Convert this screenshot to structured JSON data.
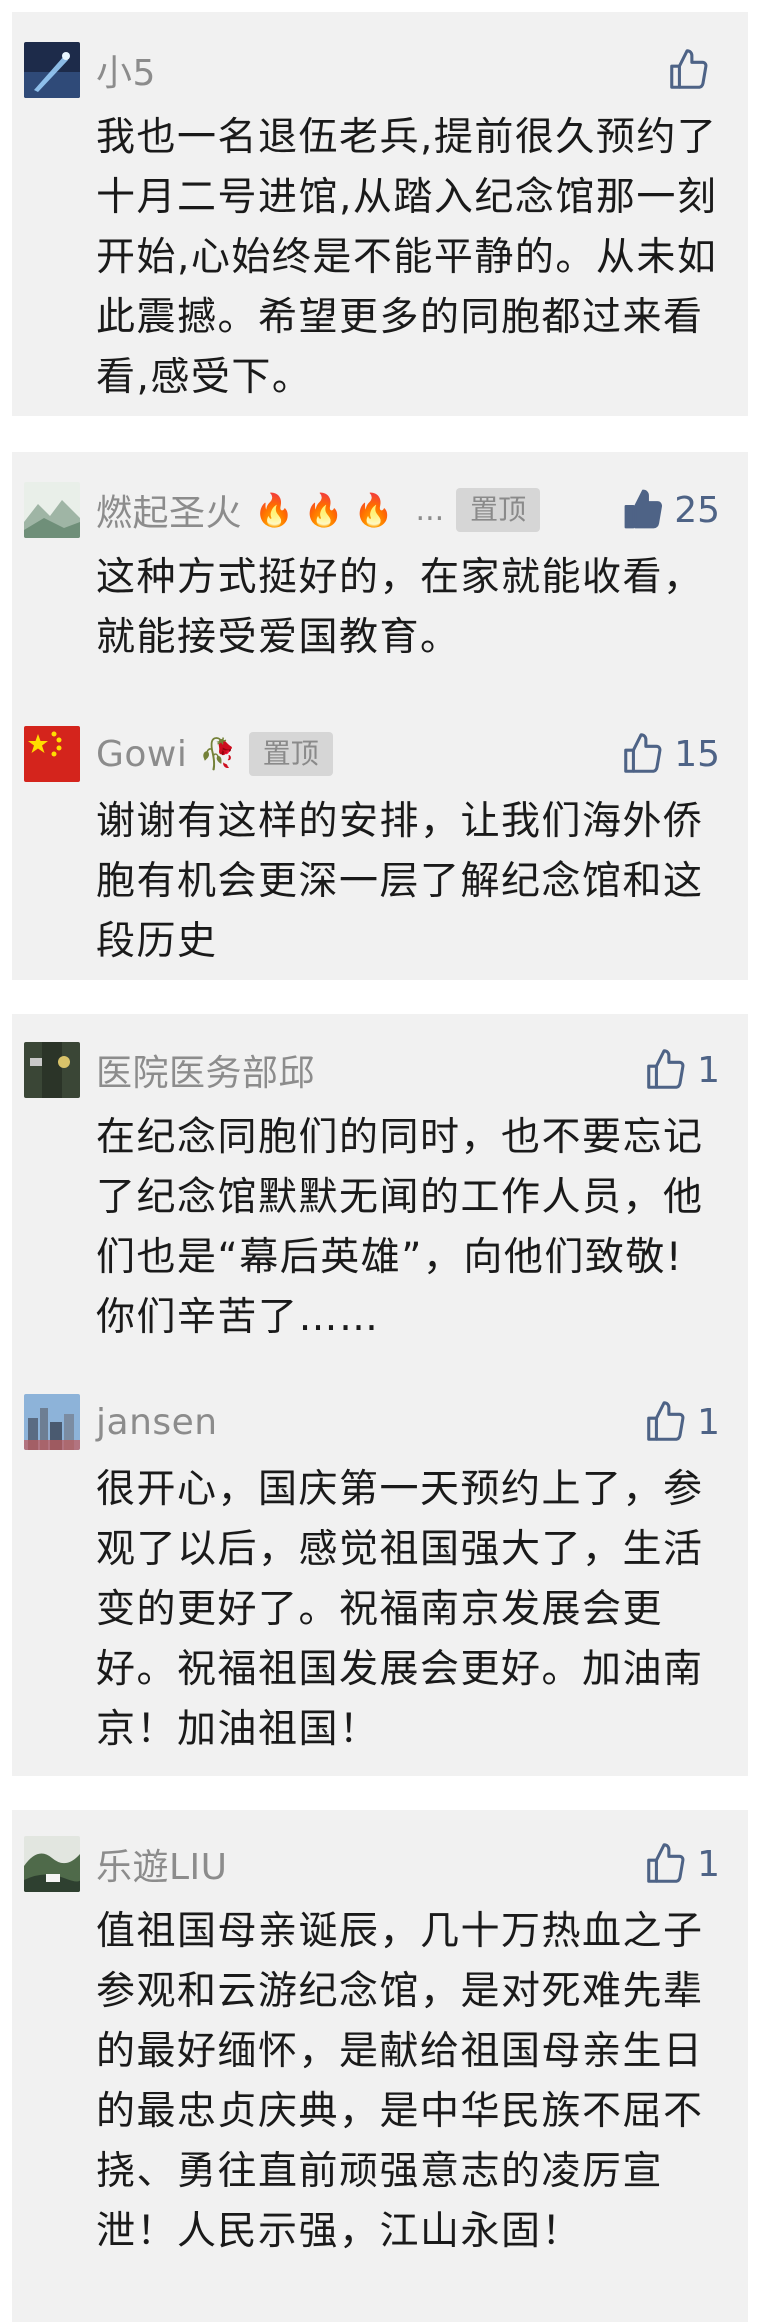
{
  "colors": {
    "card_bg": "#f1f1f1",
    "name": "#8c8c8c",
    "text": "#1a1a1a",
    "like_blue": "#4e6386",
    "pin_bg": "#d6d6d6"
  },
  "comments": [
    {
      "name": "小5",
      "likes": "",
      "liked": false,
      "pinned": false,
      "text": "我也一名退伍老兵,提前很久预约了十月二号进馆,从踏入纪念馆那一刻开始,心始终是不能平静的。从未如此震撼。希望更多的同胞都过来看看,感受下。",
      "avatar_icon": "night-sky-avatar"
    },
    {
      "name": "燃起圣火",
      "flames": "🔥🔥🔥",
      "ellipsis": "...",
      "pin_label": "置顶",
      "likes": "25",
      "liked": true,
      "pinned": true,
      "text": "这种方式挺好的，在家就能收看，就能接受爱国教育。",
      "avatar_icon": "mountain-landscape-avatar"
    },
    {
      "name": "Gowi",
      "rose": "🥀",
      "pin_label": "置顶",
      "likes": "15",
      "liked": false,
      "pinned": true,
      "text": "谢谢有这样的安排，让我们海外侨胞有机会更深一层了解纪念馆和这段历史",
      "avatar_icon": "flag-avatar"
    },
    {
      "name": "医院医务部邱",
      "likes": "1",
      "liked": false,
      "pinned": false,
      "text": "在纪念同胞们的同时，也不要忘记了纪念馆默默无闻的工作人员，他们也是“幕后英雄”，向他们致敬!你们辛苦了……",
      "avatar_icon": "uniform-avatar"
    },
    {
      "name": "jansen",
      "likes": "1",
      "liked": false,
      "pinned": false,
      "text": "很开心，国庆第一天预约上了，参观了以后，感觉祖国强大了，生活变的更好了。祝福南京发展会更好。祝福祖国发展会更好。加油南京！加油祖国！",
      "avatar_icon": "cityscape-avatar"
    },
    {
      "name": "乐遊LIU",
      "likes": "1",
      "liked": false,
      "pinned": false,
      "text": "值祖国母亲诞辰，几十万热血之子参观和云游纪念馆，是对死难先辈的最好缅怀，是献给祖国母亲生日的最忠贞庆典，是中华民族不屈不挠、勇往直前顽强意志的凌厉宣泄！人民示强，江山永固！",
      "avatar_icon": "garden-avatar"
    }
  ]
}
